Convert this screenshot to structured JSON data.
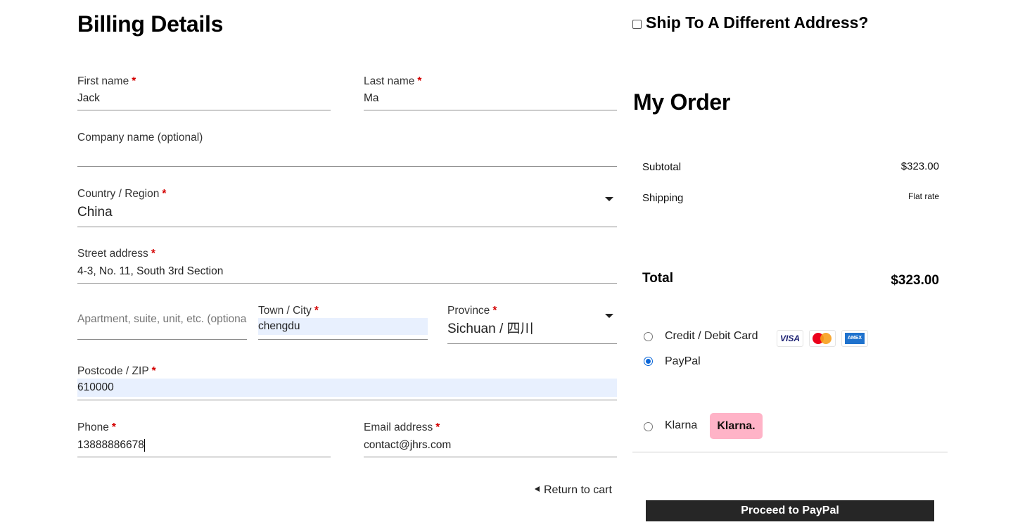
{
  "billing": {
    "title": "Billing Details",
    "required_mark": "*",
    "first_name": {
      "label": "First name",
      "value": "Jack"
    },
    "last_name": {
      "label": "Last name",
      "value": "Ma"
    },
    "company": {
      "label": "Company name (optional)",
      "value": ""
    },
    "country": {
      "label": "Country / Region",
      "value": "China"
    },
    "street": {
      "label": "Street address",
      "value": "4-3, No. 11, South 3rd Section"
    },
    "apartment": {
      "placeholder": "Apartment, suite, unit, etc. (optional)",
      "value": ""
    },
    "city": {
      "label": "Town / City",
      "value": "chengdu"
    },
    "province": {
      "label": "Province",
      "value": "Sichuan / 四川"
    },
    "postcode": {
      "label": "Postcode / ZIP",
      "value": "610000"
    },
    "phone": {
      "label": "Phone",
      "value": "13888886678"
    },
    "email": {
      "label": "Email address",
      "value": "contact@jhrs.com"
    }
  },
  "shipping": {
    "label": "Ship To A Different Address?",
    "checked": false
  },
  "order": {
    "title": "My Order",
    "subtotal": {
      "label": "Subtotal",
      "value": "$323.00"
    },
    "shipping": {
      "label": "Shipping",
      "value": "Flat rate"
    },
    "total": {
      "label": "Total",
      "value": "$323.00"
    }
  },
  "payment": {
    "methods": [
      {
        "label": "Credit / Debit Card",
        "selected": false,
        "logos": [
          "VISA",
          "mastercard-icon",
          "amex-icon"
        ]
      },
      {
        "label": "PayPal",
        "selected": true
      },
      {
        "label": "Klarna",
        "selected": false,
        "badge": "Klarna."
      }
    ],
    "visa_text": "VISA",
    "amex_text": "AMEX",
    "accent_color": "#0a66d8",
    "klarna_color": "#ffb3c7"
  },
  "actions": {
    "return_to_cart": "Return to cart",
    "proceed": "Proceed to PayPal"
  }
}
